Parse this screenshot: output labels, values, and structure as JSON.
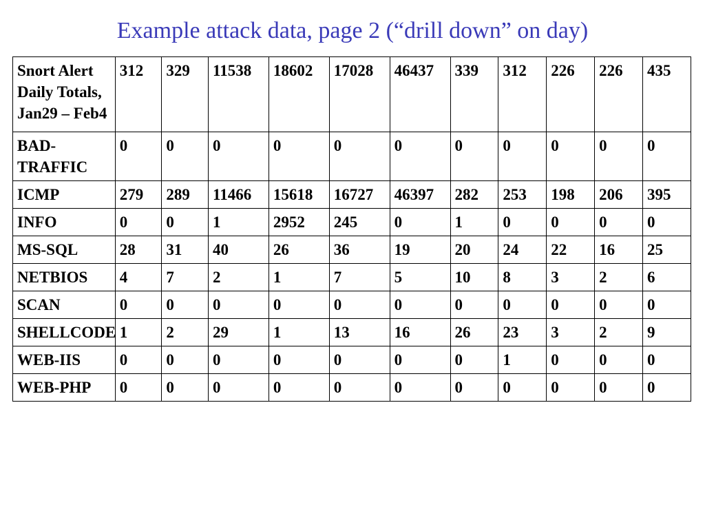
{
  "title": "Example attack data, page 2 (“drill down” on day)",
  "chart_data": {
    "type": "table",
    "header_label": "Snort Alert Daily Totals, Jan29 – Feb4",
    "columns": [
      "312",
      "329",
      "11538",
      "18602",
      "17028",
      "46437",
      "339",
      "312",
      "226",
      "226",
      "435"
    ],
    "rows": [
      {
        "label": "BAD-TRAFFIC",
        "values": [
          "0",
          "0",
          "0",
          "0",
          "0",
          "0",
          "0",
          "0",
          "0",
          "0",
          "0"
        ]
      },
      {
        "label": "ICMP",
        "values": [
          "279",
          "289",
          "11466",
          "15618",
          "16727",
          "46397",
          "282",
          "253",
          "198",
          "206",
          "395"
        ]
      },
      {
        "label": "INFO",
        "values": [
          "0",
          "0",
          "1",
          "2952",
          "245",
          "0",
          "1",
          "0",
          "0",
          "0",
          "0"
        ]
      },
      {
        "label": "MS-SQL",
        "values": [
          "28",
          "31",
          "40",
          "26",
          "36",
          "19",
          "20",
          "24",
          "22",
          "16",
          "25"
        ]
      },
      {
        "label": "NETBIOS",
        "values": [
          "4",
          "7",
          "2",
          "1",
          "7",
          "5",
          "10",
          "8",
          "3",
          "2",
          "6"
        ]
      },
      {
        "label": "SCAN",
        "values": [
          "0",
          "0",
          "0",
          "0",
          "0",
          "0",
          "0",
          "0",
          "0",
          "0",
          "0"
        ]
      },
      {
        "label": "SHELLCODE",
        "values": [
          "1",
          "2",
          "29",
          "1",
          "13",
          "16",
          "26",
          "23",
          "3",
          "2",
          "9"
        ]
      },
      {
        "label": "WEB-IIS",
        "values": [
          "0",
          "0",
          "0",
          "0",
          "0",
          "0",
          "0",
          "1",
          "0",
          "0",
          "0"
        ]
      },
      {
        "label": "WEB-PHP",
        "values": [
          "0",
          "0",
          "0",
          "0",
          "0",
          "0",
          "0",
          "0",
          "0",
          "0",
          "0"
        ]
      }
    ]
  }
}
